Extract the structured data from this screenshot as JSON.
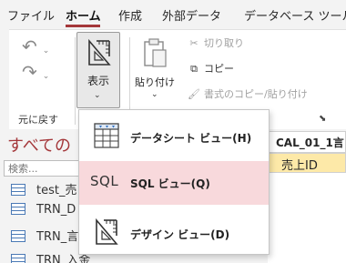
{
  "menu_tabs": [
    {
      "label": "ファイル",
      "active": false
    },
    {
      "label": "ホーム",
      "active": true
    },
    {
      "label": "作成",
      "active": false
    },
    {
      "label": "外部データ",
      "active": false
    },
    {
      "label": "データベース ツール",
      "active": false
    }
  ],
  "ribbon": {
    "undo_group_label": "元に戻す",
    "view_button_label": "表示",
    "paste_label": "貼り付け",
    "cut_label": "切り取り",
    "copy_label": "コピー",
    "format_painter_label": "書式のコピー/貼り付け",
    "launcher_icon": "dialog-launcher-icon"
  },
  "view_dropdown": {
    "items": [
      {
        "label": "データシート ビュー(H)",
        "icon": "datasheet-view-icon",
        "highlighted": false
      },
      {
        "label": "SQL ビュー(Q)",
        "icon_text": "SQL",
        "highlighted": true
      },
      {
        "label": "デザイン ビュー(D)",
        "icon": "design-view-icon",
        "highlighted": false
      }
    ]
  },
  "nav_pane": {
    "title": "すべての",
    "search_placeholder": "検索...",
    "items": [
      {
        "label": "test_売"
      },
      {
        "label": "TRN_D"
      },
      {
        "label": "TRN_言"
      },
      {
        "label": "TRN_入金"
      }
    ]
  },
  "table_view": {
    "tab_title": "CAL_01_1言",
    "field_name": "売上ID"
  },
  "colors": {
    "accent": "#a4373a",
    "highlight": "#f8d9dc",
    "field_cell": "#fde9a8"
  }
}
